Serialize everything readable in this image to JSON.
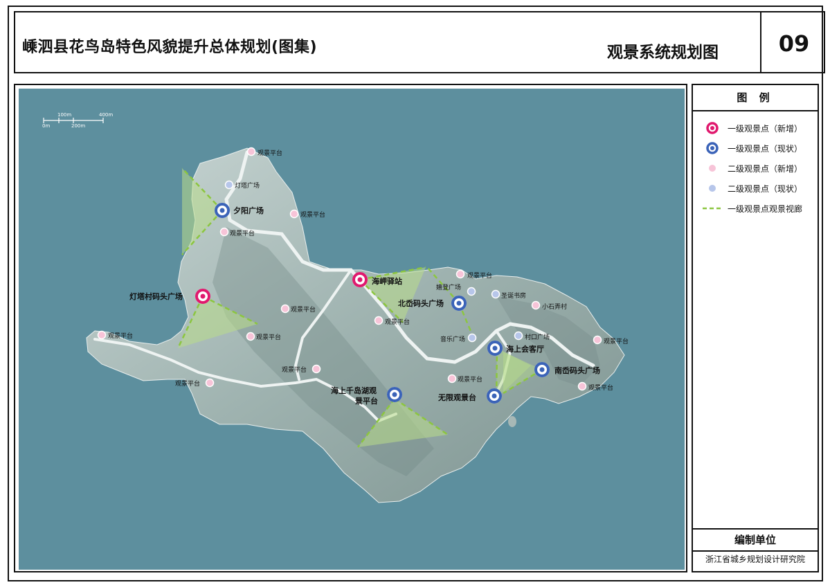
{
  "header": {
    "title": "嵊泗县花鸟岛特色风貌提升总体规划(图集)",
    "sheet_title": "观景系统规划图",
    "sheet_number": "09"
  },
  "scale_bar": {
    "top_labels": [
      "100m",
      "400m"
    ],
    "bottom_labels": [
      "0m",
      "200m"
    ]
  },
  "map": {
    "points": [
      {
        "label": "夕阳广场",
        "type": "primary-existing"
      },
      {
        "label": "海岬驿站",
        "type": "primary-new"
      },
      {
        "label": "灯塔村码头广场",
        "type": "primary-new"
      },
      {
        "label": "北岙码头广场",
        "type": "primary-existing"
      },
      {
        "label": "海上会客厅",
        "type": "primary-existing"
      },
      {
        "label": "南岙码头广场",
        "type": "primary-existing"
      },
      {
        "label": "无限观景台",
        "type": "primary-existing"
      },
      {
        "label": "海上千岛湖观景平台",
        "type": "primary-existing"
      },
      {
        "label": "灯塔广场",
        "type": "secondary-existing"
      },
      {
        "label": "嬉登广场",
        "type": "secondary-existing"
      },
      {
        "label": "圣诞书房",
        "type": "secondary-existing"
      },
      {
        "label": "音乐广场",
        "type": "secondary-existing"
      },
      {
        "label": "村口广场",
        "type": "secondary-existing"
      },
      {
        "label": "小石弄村",
        "type": "secondary-new"
      },
      {
        "label": "观景平台",
        "type": "secondary-new"
      }
    ],
    "labels": {
      "xiyang": "夕阳广场",
      "haijia": "海岬驿站",
      "dengta_matou": "灯塔村码头广场",
      "beiao": "北岙码头广场",
      "haishang_huiketing": "海上会客厅",
      "nanao": "南岙码头广场",
      "wuxian": "无限观景台",
      "qiandaohu_1": "海上千岛湖观",
      "qiandaohu_2": "景平台",
      "dengta_guangchang": "灯塔广场",
      "xideng": "嬉登广场",
      "shengdan": "圣诞书房",
      "yinyue": "音乐广场",
      "cunkou": "村口广场",
      "xiaoshi": "小石弄村",
      "guanjing": "观景平台"
    }
  },
  "legend": {
    "title": "图 例",
    "items": [
      {
        "label": "一级观景点（新增）",
        "symbol": "primary-new"
      },
      {
        "label": "一级观景点（现状）",
        "symbol": "primary-existing"
      },
      {
        "label": "二级观景点（新增）",
        "symbol": "secondary-new"
      },
      {
        "label": "二级观景点（现状）",
        "symbol": "secondary-existing"
      },
      {
        "label": "一级观景点观景视廊",
        "symbol": "corridor-line"
      }
    ],
    "unit_heading": "编制单位",
    "unit_name": "浙江省城乡规划设计研究院"
  },
  "colors": {
    "sea": "#5d8f9e",
    "primary_new": "#e0196e",
    "primary_existing": "#3b63b8",
    "secondary_new": "#f7c4d8",
    "secondary_existing": "#b7c6ea",
    "corridor": "#8cc63f"
  }
}
